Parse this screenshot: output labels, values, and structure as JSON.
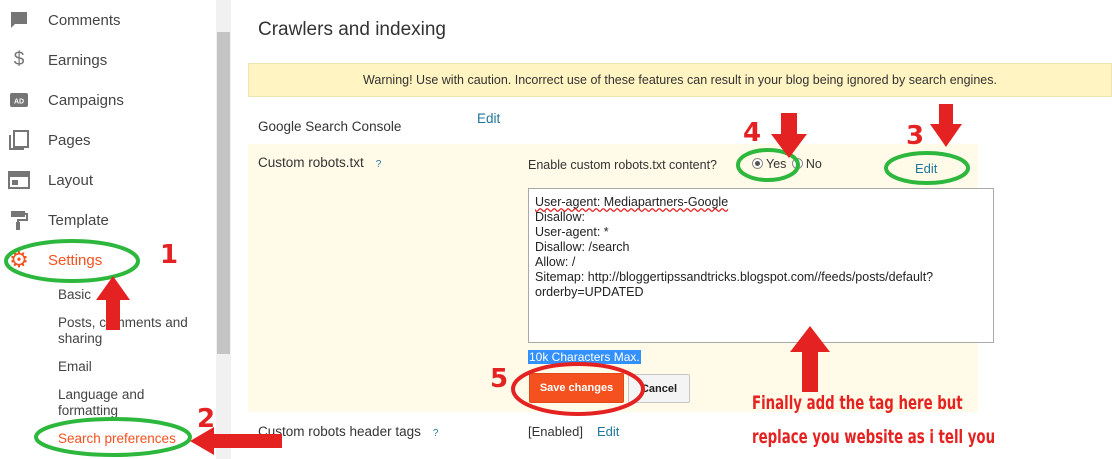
{
  "sidebar": {
    "items": [
      {
        "label": "Comments",
        "icon": "comment-icon"
      },
      {
        "label": "Earnings",
        "icon": "dollar-icon"
      },
      {
        "label": "Campaigns",
        "icon": "ad-icon"
      },
      {
        "label": "Pages",
        "icon": "pages-icon"
      },
      {
        "label": "Layout",
        "icon": "layout-icon"
      },
      {
        "label": "Template",
        "icon": "paint-roller-icon"
      },
      {
        "label": "Settings",
        "icon": "gear-icon"
      }
    ],
    "sub_items": [
      {
        "label": "Basic"
      },
      {
        "label": "Posts, comments and sharing"
      },
      {
        "label": "Email"
      },
      {
        "label": "Language and formatting"
      },
      {
        "label": "Search preferences"
      }
    ]
  },
  "main": {
    "title": "Crawlers and indexing",
    "warning": "Warning! Use with caution. Incorrect use of these features can result in your blog being ignored by search engines.",
    "search_console": {
      "label": "Google Search Console",
      "edit": "Edit"
    },
    "custom_robots": {
      "label": "Custom robots.txt",
      "help": "?",
      "question": "Enable custom robots.txt content?",
      "yes": "Yes",
      "no": "No",
      "edit": "Edit",
      "lines": [
        "User-agent: Mediapartners-Google",
        "Disallow:",
        "User-agent: *",
        "Disallow: /search",
        "Allow: /",
        "Sitemap: http://bloggertipssandtricks.blogspot.com//feeds/posts/default?",
        "orderby=UPDATED"
      ],
      "char_limit": "10k Characters Max.",
      "save": "Save changes",
      "cancel": "Cancel"
    },
    "header_tags": {
      "label": "Custom robots header tags",
      "help": "?",
      "value": "[Enabled]",
      "edit": "Edit"
    }
  },
  "annotations": {
    "numbers": [
      "1",
      "2",
      "3",
      "4",
      "5"
    ],
    "note_line1": "Finally add the tag here but",
    "note_line2": "replace you website as i tell you",
    "arrow_color": "#e52222",
    "circle_color": "#2db83d"
  }
}
